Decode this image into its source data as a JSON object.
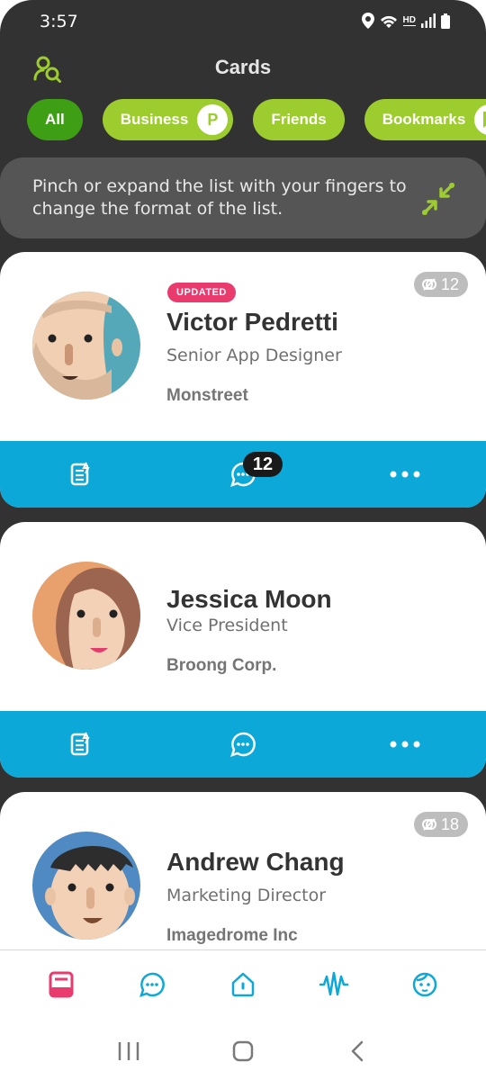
{
  "status_bar": {
    "time": "3:57",
    "icons": [
      "location-icon",
      "wifi-icon",
      "hd-voice-icon",
      "signal-icon",
      "battery-icon"
    ],
    "hd_label": "HD"
  },
  "header": {
    "title": "Cards"
  },
  "filters": [
    {
      "label": "All",
      "active": true
    },
    {
      "label": "Business",
      "badge": "P"
    },
    {
      "label": "Friends"
    },
    {
      "label": "Bookmarks",
      "badge_icon": "bookmark-icon"
    }
  ],
  "hint": {
    "text": "Pinch or expand the list with your fingers to change the format of the list."
  },
  "cards": [
    {
      "name": "Victor Pedretti",
      "role": "Senior App Designer",
      "company": "Monstreet",
      "tag": "UPDATED",
      "links": "12",
      "message_count": "12"
    },
    {
      "name": "Jessica Moon",
      "role": "Vice President",
      "company": "Broong Corp."
    },
    {
      "name": "Andrew Chang",
      "role": "Marketing Director",
      "company": "Imagedrome Inc",
      "links": "18"
    }
  ],
  "colors": {
    "background": "#323232",
    "accent_green": "#9ccc2e",
    "active_green": "#3f9f14",
    "action_blue": "#0ba8d8",
    "updated_pink": "#e93b6e"
  },
  "bottom_nav": [
    "cards-icon",
    "chat-icon",
    "home-icon",
    "activity-icon",
    "profile-icon"
  ],
  "system_nav": [
    "recents-icon",
    "home-button-icon",
    "back-icon"
  ]
}
